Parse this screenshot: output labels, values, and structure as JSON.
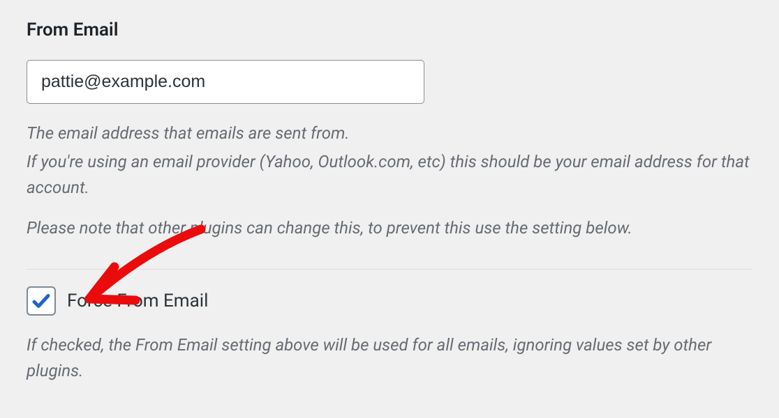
{
  "from_email": {
    "label": "From Email",
    "value": "pattie@example.com",
    "help_line1": "The email address that emails are sent from.",
    "help_line2": "If you're using an email provider (Yahoo, Outlook.com, etc) this should be your email address for that account.",
    "help_line3": "Please note that other plugins can change this, to prevent this use the setting below."
  },
  "force_from_email": {
    "checked": true,
    "label": "Force From Email",
    "help": "If checked, the From Email setting above will be used for all emails, ignoring values set by other plugins."
  }
}
